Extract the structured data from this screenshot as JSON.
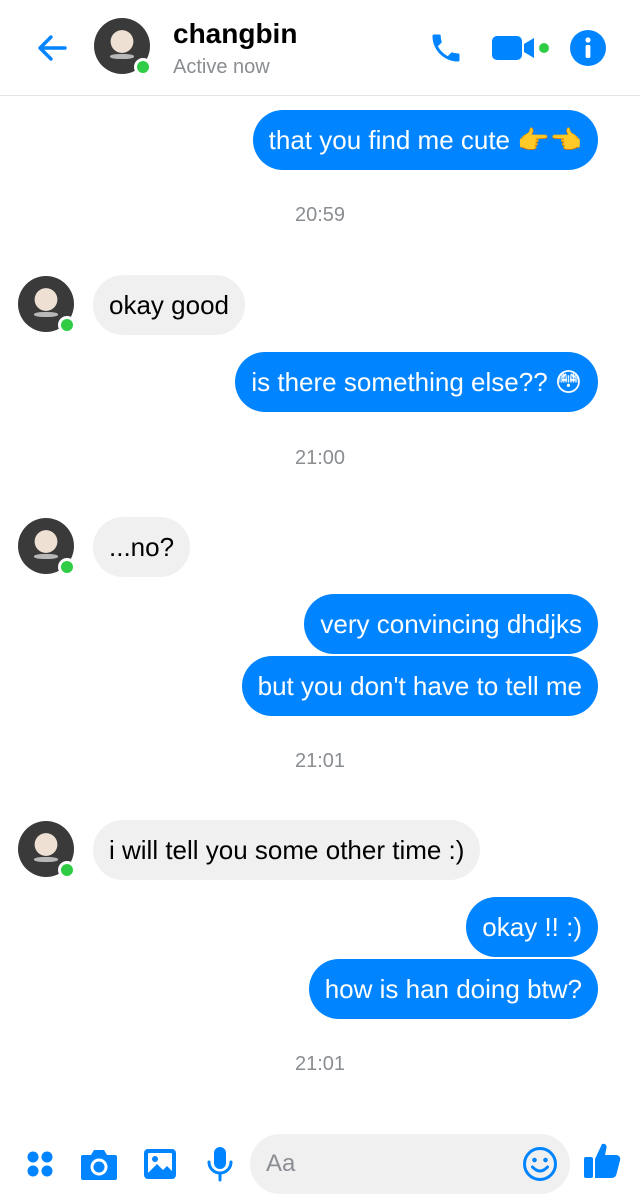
{
  "header": {
    "back_icon": "arrow-left-icon",
    "contact_name": "changbin",
    "status": "Active now",
    "actions": [
      "phone-icon",
      "video-camera-icon",
      "info-icon"
    ],
    "accent": "#0084ff",
    "online_color": "#31cc46"
  },
  "messages": [
    {
      "type": "outgoing",
      "text": "that you find me cute 👉👈"
    },
    {
      "type": "timestamp",
      "text": "20:59"
    },
    {
      "type": "incoming",
      "text": "okay good"
    },
    {
      "type": "outgoing",
      "text": "is there something else?? 😳"
    },
    {
      "type": "timestamp",
      "text": "21:00"
    },
    {
      "type": "incoming",
      "text": "...no?"
    },
    {
      "type": "outgoing",
      "text": "very convincing dhdjks"
    },
    {
      "type": "outgoing",
      "text": "but you don't have to tell me"
    },
    {
      "type": "timestamp",
      "text": "21:01"
    },
    {
      "type": "incoming",
      "text": "i will tell you some other time :)"
    },
    {
      "type": "outgoing",
      "text": "okay !! :)"
    },
    {
      "type": "outgoing",
      "text": "how is han doing btw?"
    },
    {
      "type": "timestamp",
      "text": "21:01"
    }
  ],
  "composer": {
    "icons": [
      "apps-icon",
      "camera-icon",
      "image-icon",
      "microphone-icon"
    ],
    "placeholder": "Aa",
    "emoji_icon": "smiley-icon",
    "send_icon": "thumbs-up-icon"
  },
  "colors": {
    "outgoing_bubble": "#0084ff",
    "incoming_bubble": "#f0f0f0",
    "muted_text": "#8a8d91"
  }
}
